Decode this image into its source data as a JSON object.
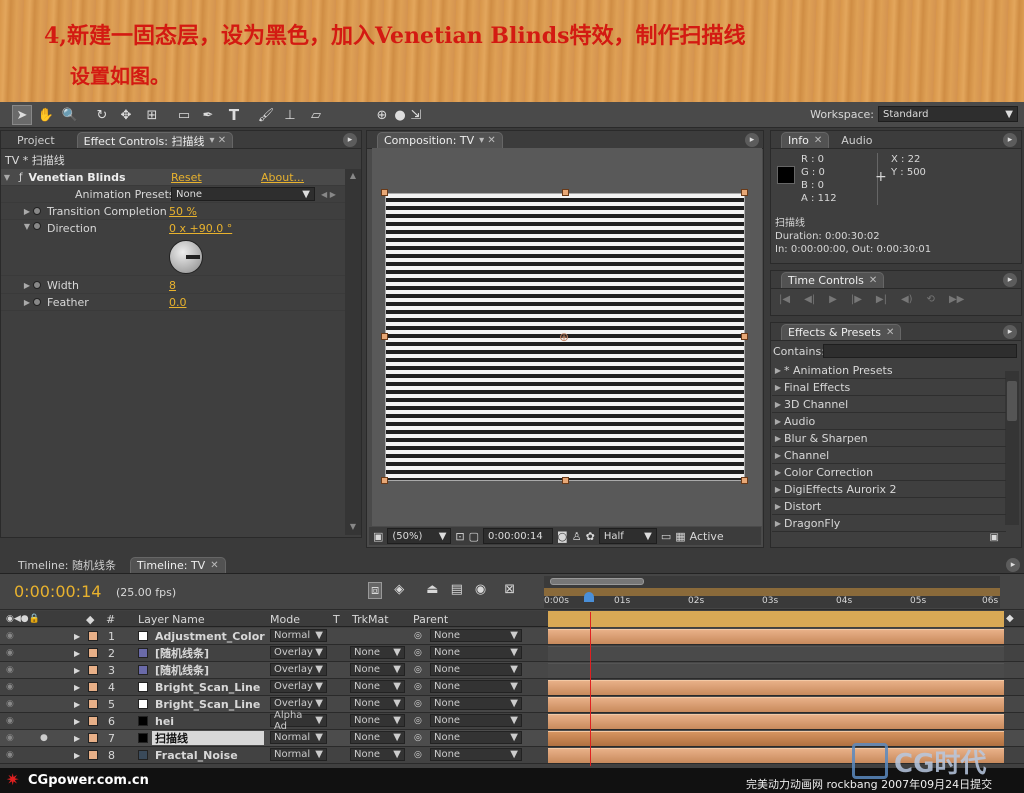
{
  "header": {
    "line1": "4,新建一固态层，设为黑色，加入Venetian Blinds特效，制作扫描线",
    "line2": "设置如图。"
  },
  "toolbar": {
    "tools": [
      "arrow-tool",
      "hand-tool",
      "zoom-tool",
      "rotate-tool",
      "orbit-tool",
      "pan-behind-tool",
      "rectangle-tool",
      "pen-tool",
      "type-tool",
      "brush-tool",
      "clone-stamp-tool",
      "eraser-tool"
    ],
    "workspace_label": "Workspace:",
    "workspace_value": "Standard"
  },
  "left_panel": {
    "tab_project": "Project",
    "tab_effects": "Effect Controls: 扫描线",
    "subtitle": "TV * 扫描线",
    "effect_name": "Venetian Blinds",
    "reset": "Reset",
    "about": "About...",
    "presets_label": "Animation Presets:",
    "presets_value": "None",
    "params": [
      {
        "label": "Transition Completion",
        "value": "50 %"
      },
      {
        "label": "Direction",
        "value": "0 x +90.0 °"
      },
      {
        "label": "Width",
        "value": "8"
      },
      {
        "label": "Feather",
        "value": "0.0"
      }
    ]
  },
  "composition": {
    "tab": "Composition: TV",
    "zoom": "(50%)",
    "timecode": "0:00:00:14",
    "resolution": "Half",
    "camera": "Active"
  },
  "info": {
    "tab_info": "Info",
    "tab_audio": "Audio",
    "r": "R : 0",
    "g": "G : 0",
    "b": "B : 0",
    "a": "A : 112",
    "x": "X : 22",
    "y": "Y : 500",
    "layer": "扫描线",
    "duration": "Duration: 0:00:30:02",
    "inout": "In: 0:00:00:00, Out: 0:00:30:01"
  },
  "time_controls": {
    "tab": "Time Controls"
  },
  "effects_presets": {
    "tab": "Effects & Presets",
    "contains_label": "Contains:",
    "items": [
      "* Animation Presets",
      "Final Effects",
      "3D Channel",
      "Audio",
      "Blur & Sharpen",
      "Channel",
      "Color Correction",
      "DigiEffects Aurorix 2",
      "Distort",
      "DragonFly"
    ]
  },
  "timeline": {
    "tab1": "Timeline: 随机线条",
    "tab2": "Timeline: TV",
    "timecode": "0:00:00:14",
    "fps": "(25.00 fps)",
    "col_num": "#",
    "col_name": "Layer Name",
    "col_mode": "Mode",
    "col_t": "T",
    "col_trkmat": "TrkMat",
    "col_parent": "Parent",
    "ruler": [
      "0:00s",
      "01s",
      "02s",
      "03s",
      "04s",
      "05s",
      "06s"
    ],
    "layers": [
      {
        "num": "1",
        "name": "Adjustment_Color",
        "mode": "Normal",
        "trkmat": "",
        "parent": "None",
        "color": "#ffffff"
      },
      {
        "num": "2",
        "name": "[随机线条]",
        "mode": "Overlay",
        "trkmat": "None",
        "parent": "None",
        "color": "#6a6aa8"
      },
      {
        "num": "3",
        "name": "[随机线条]",
        "mode": "Overlay",
        "trkmat": "None",
        "parent": "None",
        "color": "#6a6aa8"
      },
      {
        "num": "4",
        "name": "Bright_Scan_Line",
        "mode": "Overlay",
        "trkmat": "None",
        "parent": "None",
        "color": "#ffffff"
      },
      {
        "num": "5",
        "name": "Bright_Scan_Line",
        "mode": "Overlay",
        "trkmat": "None",
        "parent": "None",
        "color": "#ffffff"
      },
      {
        "num": "6",
        "name": "hei",
        "mode": "Alpha Ad",
        "trkmat": "None",
        "parent": "None",
        "color": "#000000"
      },
      {
        "num": "7",
        "name": "扫描线",
        "mode": "Normal",
        "trkmat": "None",
        "parent": "None",
        "color": "#000000"
      },
      {
        "num": "8",
        "name": "Fractal_Noise",
        "mode": "Normal",
        "trkmat": "None",
        "parent": "None",
        "color": "#3a4a5a"
      }
    ]
  },
  "footer": {
    "left": "CGpower.com.cn",
    "right": "完美动力动画网 rockbang 2007年09月24日提交",
    "logo": "CG时代"
  }
}
